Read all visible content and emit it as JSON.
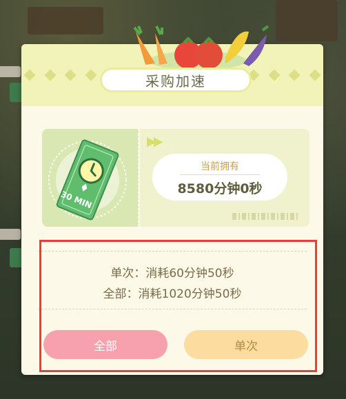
{
  "dialog": {
    "title": "采购加速"
  },
  "ticket": {
    "badge_text": "30 MIN",
    "owned_label": "当前拥有",
    "owned_value": "8580分钟0秒"
  },
  "cost": {
    "single": "单次：消耗60分钟50秒",
    "all": "全部：消耗1020分钟50秒"
  },
  "buttons": {
    "all_label": "全部",
    "single_label": "单次"
  },
  "colors": {
    "header": "#f1f3b8",
    "panel": "#fdf9e9",
    "btn_all": "#f7a0ae",
    "btn_single": "#fcdc9f",
    "highlight": "#ec3b3b"
  }
}
